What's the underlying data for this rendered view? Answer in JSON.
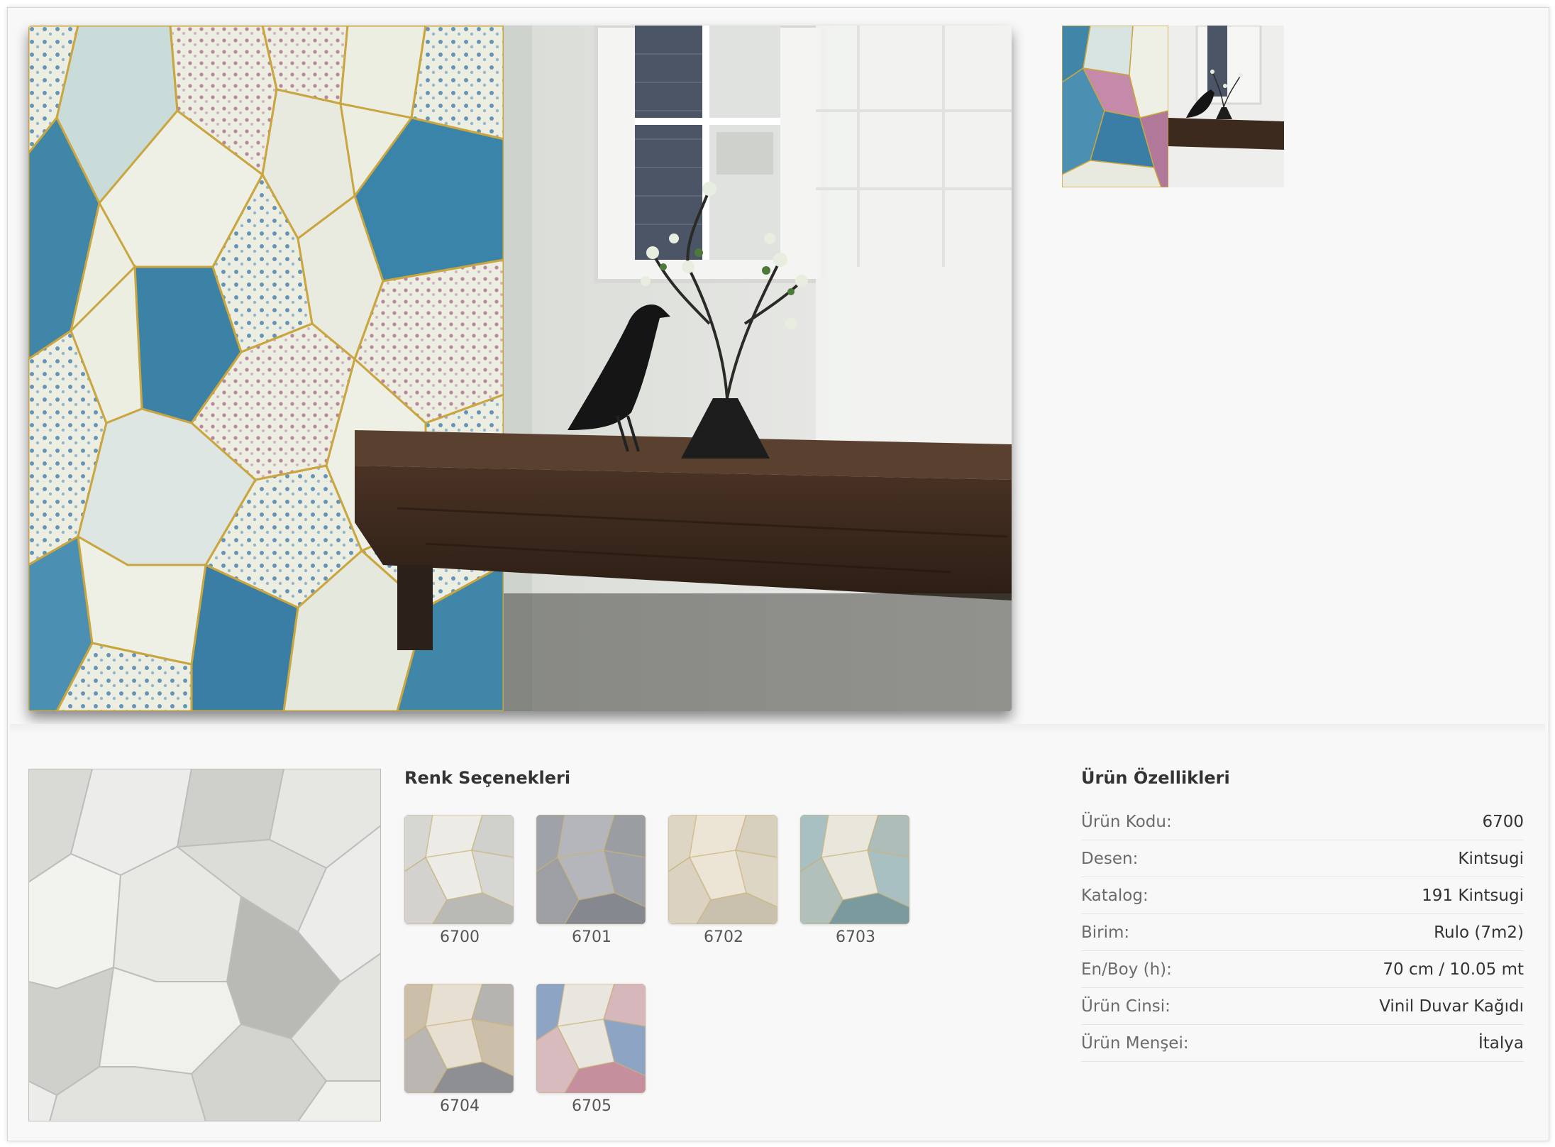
{
  "images": {
    "hero": "room-with-wallpaper-photo",
    "thumbnail": "room-with-wallpaper-thumbnail",
    "selected_swatch": "wallpaper-pattern-6700"
  },
  "color_options": {
    "title": "Renk Seçenekleri",
    "items": [
      {
        "code": "6700",
        "base": "#ecebe6",
        "tone": "#d6d6d2",
        "floral": "#b9b9b6"
      },
      {
        "code": "6701",
        "base": "#b4b6bb",
        "tone": "#9fa2a8",
        "floral": "#85888e"
      },
      {
        "code": "6702",
        "base": "#ece5d6",
        "tone": "#ded6c4",
        "floral": "#c9c0ad"
      },
      {
        "code": "6703",
        "base": "#e9e7db",
        "tone": "#a9c0c2",
        "floral": "#7b9a9e"
      },
      {
        "code": "6704",
        "base": "#e6dfd2",
        "tone": "#cbbfaa",
        "floral": "#8e8f93"
      },
      {
        "code": "6705",
        "base": "#e9e6df",
        "tone": "#8ea4c4",
        "floral": "#c58f9e"
      }
    ]
  },
  "product_properties": {
    "title": "Ürün Özellikleri",
    "rows": [
      {
        "label": "Ürün Kodu:",
        "value": "6700"
      },
      {
        "label": "Desen:",
        "value": "Kintsugi"
      },
      {
        "label": "Katalog:",
        "value": "191 Kintsugi"
      },
      {
        "label": "Birim:",
        "value": "Rulo (7m2)"
      },
      {
        "label": "En/Boy (h):",
        "value": "70 cm / 10.05 mt"
      },
      {
        "label": "Ürün Cinsi:",
        "value": "Vinil Duvar Kağıdı"
      },
      {
        "label": "Ürün Menşei:",
        "value": "İtalya"
      }
    ]
  },
  "colors": {
    "background": "#f8f8f8",
    "wall_blue": "#3f7ea8",
    "wall_pink": "#b2789a",
    "gold_lines": "#c9a640",
    "shelf_wood": "#3d2a1e"
  }
}
